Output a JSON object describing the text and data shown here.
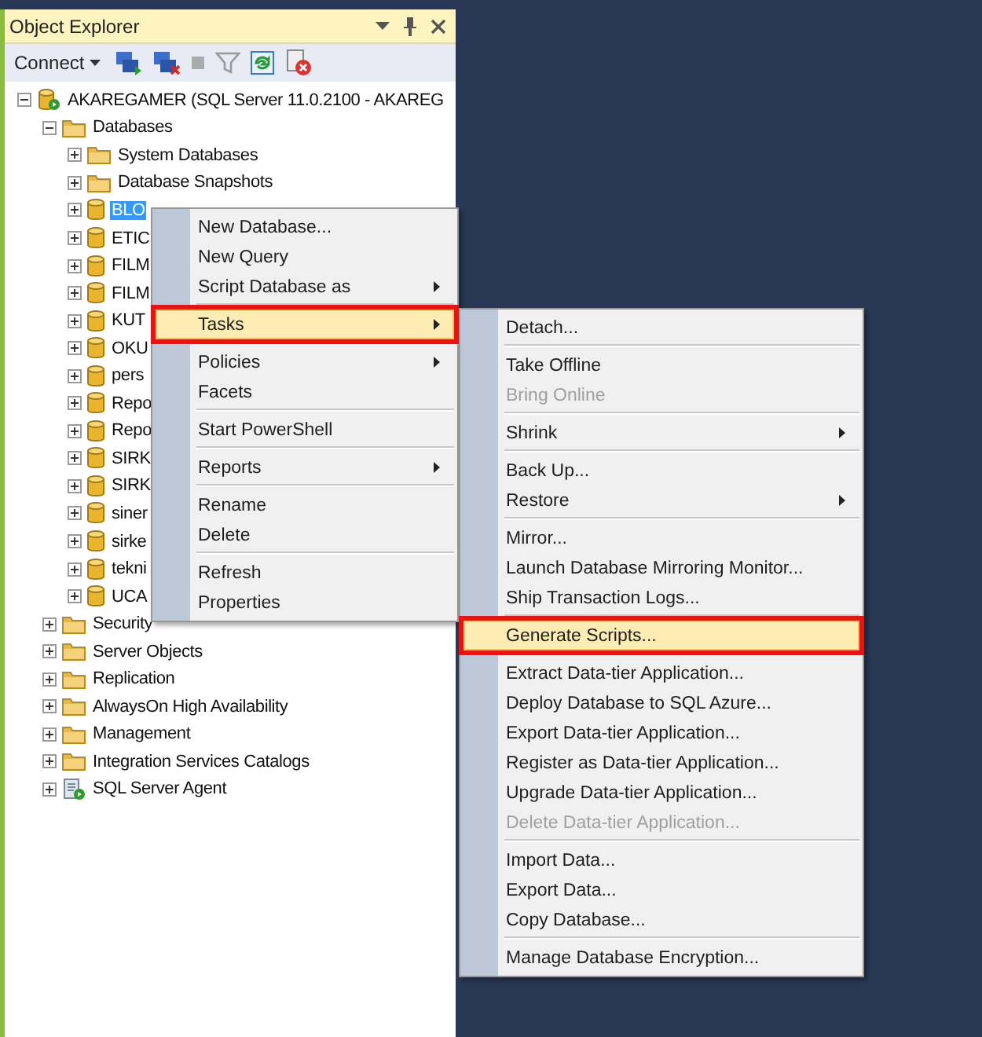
{
  "panel": {
    "title": "Object Explorer",
    "connect_label": "Connect"
  },
  "tree": [
    {
      "label": "AKAREGAMER (SQL Server 11.0.2100 - AKAREG",
      "kind": "server",
      "expanded": true,
      "selected": false,
      "children": [
        {
          "label": "Databases",
          "kind": "folder",
          "expanded": true,
          "selected": false,
          "children": [
            {
              "label": "System Databases",
              "kind": "folder",
              "expanded": false,
              "selected": false
            },
            {
              "label": "Database Snapshots",
              "kind": "folder",
              "expanded": false,
              "selected": false
            },
            {
              "label": "BLO",
              "kind": "database",
              "expanded": false,
              "selected": true
            },
            {
              "label": "ETIC",
              "kind": "database",
              "expanded": false,
              "selected": false
            },
            {
              "label": "FILM",
              "kind": "database",
              "expanded": false,
              "selected": false
            },
            {
              "label": "FILM",
              "kind": "database",
              "expanded": false,
              "selected": false
            },
            {
              "label": "KUT",
              "kind": "database",
              "expanded": false,
              "selected": false
            },
            {
              "label": "OKU",
              "kind": "database",
              "expanded": false,
              "selected": false
            },
            {
              "label": "pers",
              "kind": "database",
              "expanded": false,
              "selected": false
            },
            {
              "label": "Repo",
              "kind": "database",
              "expanded": false,
              "selected": false
            },
            {
              "label": "Repo",
              "kind": "database",
              "expanded": false,
              "selected": false
            },
            {
              "label": "SIRK",
              "kind": "database",
              "expanded": false,
              "selected": false
            },
            {
              "label": "SIRK",
              "kind": "database",
              "expanded": false,
              "selected": false
            },
            {
              "label": "siner",
              "kind": "database",
              "expanded": false,
              "selected": false
            },
            {
              "label": "sirke",
              "kind": "database",
              "expanded": false,
              "selected": false
            },
            {
              "label": "tekni",
              "kind": "database",
              "expanded": false,
              "selected": false
            },
            {
              "label": "UCA",
              "kind": "database",
              "expanded": false,
              "selected": false
            }
          ]
        },
        {
          "label": "Security",
          "kind": "folder",
          "expanded": false,
          "selected": false
        },
        {
          "label": "Server Objects",
          "kind": "folder",
          "expanded": false,
          "selected": false
        },
        {
          "label": "Replication",
          "kind": "folder",
          "expanded": false,
          "selected": false
        },
        {
          "label": "AlwaysOn High Availability",
          "kind": "folder",
          "expanded": false,
          "selected": false
        },
        {
          "label": "Management",
          "kind": "folder",
          "expanded": false,
          "selected": false
        },
        {
          "label": "Integration Services Catalogs",
          "kind": "folder",
          "expanded": false,
          "selected": false
        },
        {
          "label": "SQL Server Agent",
          "kind": "agent",
          "expanded": false,
          "selected": false
        }
      ]
    }
  ],
  "context_menu": [
    {
      "kind": "item",
      "label": "New Database...",
      "submenu": false,
      "disabled": false,
      "selected": false,
      "annotated": false
    },
    {
      "kind": "item",
      "label": "New Query",
      "submenu": false,
      "disabled": false,
      "selected": false,
      "annotated": false
    },
    {
      "kind": "item",
      "label": "Script Database as",
      "submenu": true,
      "disabled": false,
      "selected": false,
      "annotated": false
    },
    {
      "kind": "separator"
    },
    {
      "kind": "item",
      "label": "Tasks",
      "submenu": true,
      "disabled": false,
      "selected": true,
      "annotated": true
    },
    {
      "kind": "separator"
    },
    {
      "kind": "item",
      "label": "Policies",
      "submenu": true,
      "disabled": false,
      "selected": false,
      "annotated": false
    },
    {
      "kind": "item",
      "label": "Facets",
      "submenu": false,
      "disabled": false,
      "selected": false,
      "annotated": false
    },
    {
      "kind": "separator"
    },
    {
      "kind": "item",
      "label": "Start PowerShell",
      "submenu": false,
      "disabled": false,
      "selected": false,
      "annotated": false
    },
    {
      "kind": "separator"
    },
    {
      "kind": "item",
      "label": "Reports",
      "submenu": true,
      "disabled": false,
      "selected": false,
      "annotated": false
    },
    {
      "kind": "separator"
    },
    {
      "kind": "item",
      "label": "Rename",
      "submenu": false,
      "disabled": false,
      "selected": false,
      "annotated": false
    },
    {
      "kind": "item",
      "label": "Delete",
      "submenu": false,
      "disabled": false,
      "selected": false,
      "annotated": false
    },
    {
      "kind": "separator"
    },
    {
      "kind": "item",
      "label": "Refresh",
      "submenu": false,
      "disabled": false,
      "selected": false,
      "annotated": false
    },
    {
      "kind": "item",
      "label": "Properties",
      "submenu": false,
      "disabled": false,
      "selected": false,
      "annotated": false
    }
  ],
  "tasks_submenu": [
    {
      "kind": "item",
      "label": "Detach...",
      "submenu": false,
      "disabled": false,
      "selected": false,
      "annotated": false
    },
    {
      "kind": "separator"
    },
    {
      "kind": "item",
      "label": "Take Offline",
      "submenu": false,
      "disabled": false,
      "selected": false,
      "annotated": false
    },
    {
      "kind": "item",
      "label": "Bring Online",
      "submenu": false,
      "disabled": true,
      "selected": false,
      "annotated": false
    },
    {
      "kind": "separator"
    },
    {
      "kind": "item",
      "label": "Shrink",
      "submenu": true,
      "disabled": false,
      "selected": false,
      "annotated": false
    },
    {
      "kind": "separator"
    },
    {
      "kind": "item",
      "label": "Back Up...",
      "submenu": false,
      "disabled": false,
      "selected": false,
      "annotated": false
    },
    {
      "kind": "item",
      "label": "Restore",
      "submenu": true,
      "disabled": false,
      "selected": false,
      "annotated": false
    },
    {
      "kind": "separator"
    },
    {
      "kind": "item",
      "label": "Mirror...",
      "submenu": false,
      "disabled": false,
      "selected": false,
      "annotated": false
    },
    {
      "kind": "item",
      "label": "Launch Database Mirroring Monitor...",
      "submenu": false,
      "disabled": false,
      "selected": false,
      "annotated": false
    },
    {
      "kind": "item",
      "label": "Ship Transaction Logs...",
      "submenu": false,
      "disabled": false,
      "selected": false,
      "annotated": false
    },
    {
      "kind": "separator"
    },
    {
      "kind": "item",
      "label": "Generate Scripts...",
      "submenu": false,
      "disabled": false,
      "selected": true,
      "annotated": true
    },
    {
      "kind": "separator"
    },
    {
      "kind": "item",
      "label": "Extract Data-tier Application...",
      "submenu": false,
      "disabled": false,
      "selected": false,
      "annotated": false
    },
    {
      "kind": "item",
      "label": "Deploy Database to SQL Azure...",
      "submenu": false,
      "disabled": false,
      "selected": false,
      "annotated": false
    },
    {
      "kind": "item",
      "label": "Export Data-tier Application...",
      "submenu": false,
      "disabled": false,
      "selected": false,
      "annotated": false
    },
    {
      "kind": "item",
      "label": "Register as Data-tier Application...",
      "submenu": false,
      "disabled": false,
      "selected": false,
      "annotated": false
    },
    {
      "kind": "item",
      "label": "Upgrade Data-tier Application...",
      "submenu": false,
      "disabled": false,
      "selected": false,
      "annotated": false
    },
    {
      "kind": "item",
      "label": "Delete Data-tier Application...",
      "submenu": false,
      "disabled": true,
      "selected": false,
      "annotated": false
    },
    {
      "kind": "separator"
    },
    {
      "kind": "item",
      "label": "Import Data...",
      "submenu": false,
      "disabled": false,
      "selected": false,
      "annotated": false
    },
    {
      "kind": "item",
      "label": "Export Data...",
      "submenu": false,
      "disabled": false,
      "selected": false,
      "annotated": false
    },
    {
      "kind": "item",
      "label": "Copy Database...",
      "submenu": false,
      "disabled": false,
      "selected": false,
      "annotated": false
    },
    {
      "kind": "separator"
    },
    {
      "kind": "item",
      "label": "Manage Database Encryption...",
      "submenu": false,
      "disabled": false,
      "selected": false,
      "annotated": false
    }
  ]
}
